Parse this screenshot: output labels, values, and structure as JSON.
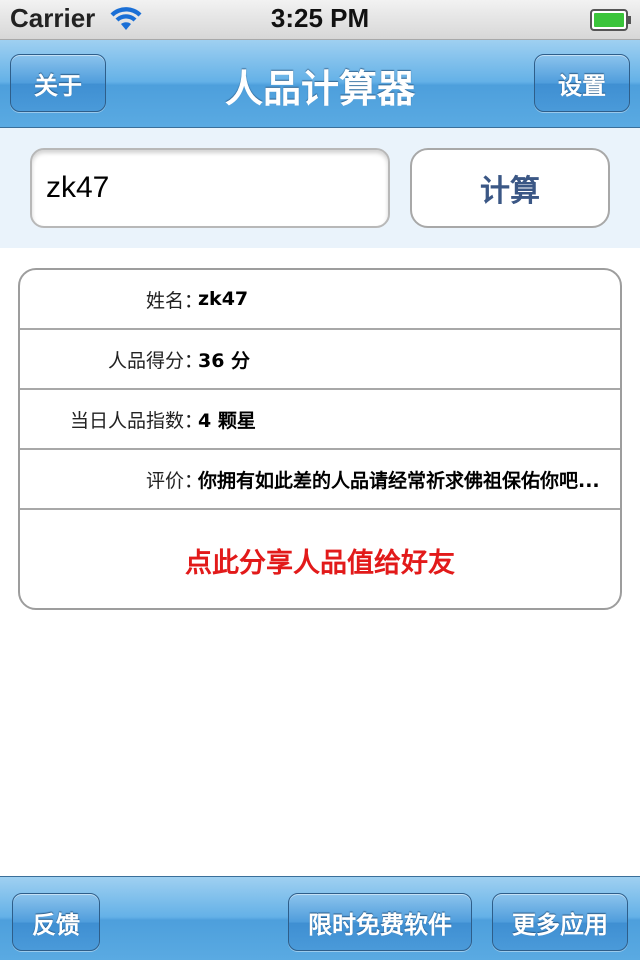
{
  "status_bar": {
    "carrier": "Carrier",
    "time": "3:25 PM",
    "wifi_icon": "wifi-icon",
    "battery_icon": "battery-full-icon",
    "battery_color": "#3ac43a"
  },
  "nav_bar": {
    "title": "人品计算器",
    "left_button": "关于",
    "right_button": "设置"
  },
  "input_area": {
    "name_value": "zk47",
    "calculate_button": "计算"
  },
  "results": {
    "rows": [
      {
        "label": "姓名",
        "value": "zk47"
      },
      {
        "label": "人品得分",
        "value": "36 分"
      },
      {
        "label": "当日人品指数",
        "value": "4 颗星"
      },
      {
        "label": "评价",
        "value": "你拥有如此差的人品请经常祈求佛祖保佑你吧..."
      }
    ],
    "colon": "：",
    "share_text": "点此分享人品值给好友",
    "share_color": "#e21a1a"
  },
  "toolbar": {
    "feedback": "反馈",
    "free_software": "限时免费软件",
    "more_apps": "更多应用"
  },
  "colors": {
    "bar_blue": "#5aaae2",
    "calc_text": "#3b5785"
  }
}
